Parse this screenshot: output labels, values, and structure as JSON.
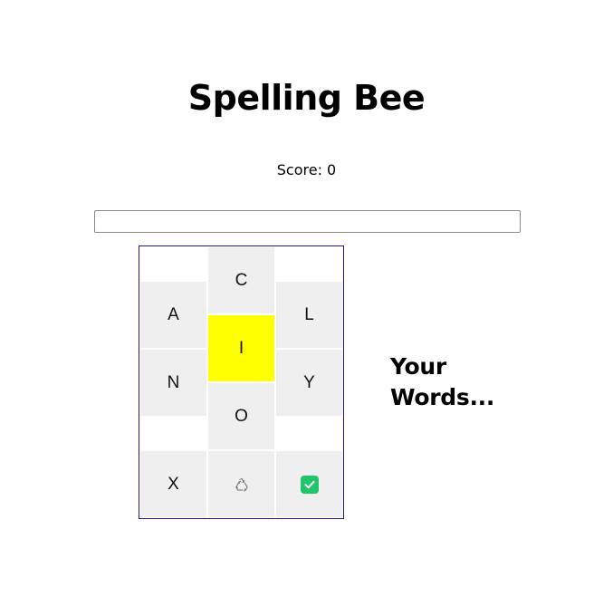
{
  "header": {
    "title": "Spelling Bee"
  },
  "score": {
    "text": "Score: 0"
  },
  "input": {
    "value": "",
    "placeholder": ""
  },
  "board": {
    "center_letter": "I",
    "outer_letters": [
      "C",
      "A",
      "L",
      "N",
      "Y",
      "O"
    ],
    "tiles": {
      "top": "C",
      "upper_left": "A",
      "upper_right": "L",
      "center": "I",
      "lower_left": "N",
      "lower_right": "Y",
      "bottom": "O"
    },
    "controls": {
      "delete_label": "X",
      "shuffle_icon": "recycle-icon",
      "submit_icon": "checkmark-icon"
    }
  },
  "colors": {
    "center_tile": "#ffff00",
    "tile": "#efefef",
    "board_border": "#1a1a8c",
    "submit_green": "#1fc46b"
  },
  "words_panel": {
    "heading_line1": "Your",
    "heading_line2": "Words..."
  }
}
